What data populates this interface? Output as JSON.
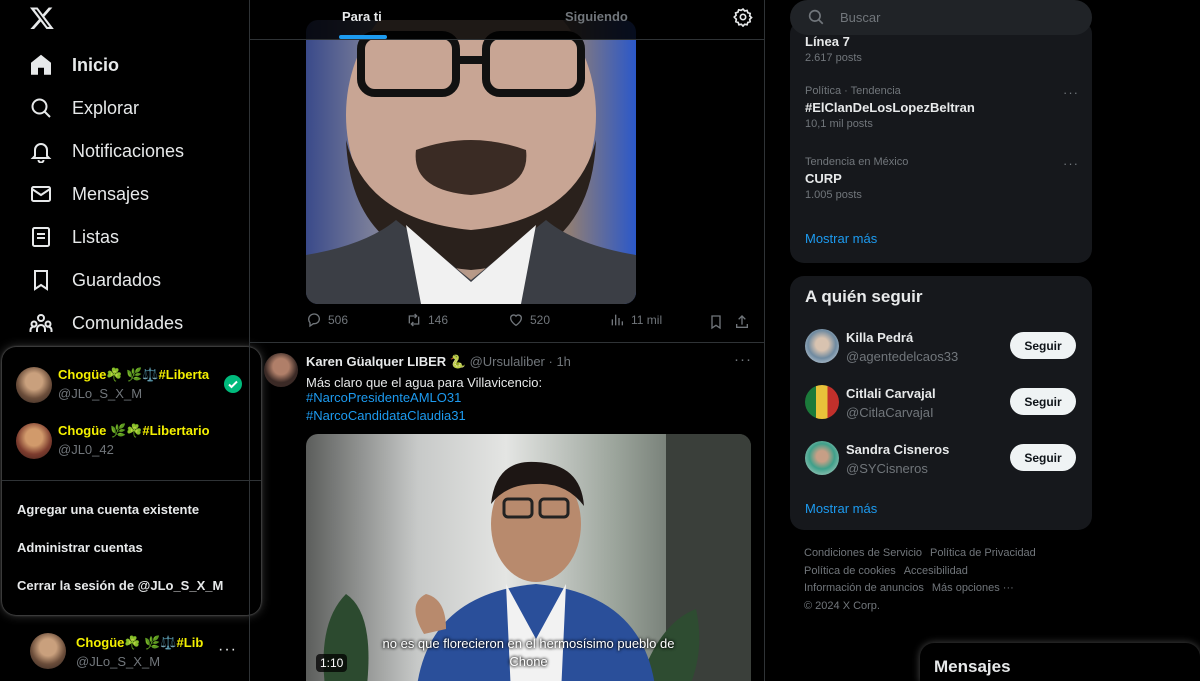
{
  "nav": {
    "items": [
      {
        "label": "Inicio",
        "icon": "home-icon",
        "active": true
      },
      {
        "label": "Explorar",
        "icon": "search-icon"
      },
      {
        "label": "Notificaciones",
        "icon": "bell-icon"
      },
      {
        "label": "Mensajes",
        "icon": "mail-icon"
      },
      {
        "label": "Listas",
        "icon": "list-icon"
      },
      {
        "label": "Guardados",
        "icon": "bookmark-icon"
      },
      {
        "label": "Comunidades",
        "icon": "communities-icon"
      }
    ]
  },
  "account_popup": {
    "accounts": [
      {
        "name": "Chogüe☘️ 🌿⚖️#Liberta",
        "handle": "@JLo_S_X_M",
        "active": true
      },
      {
        "name": "Chogüe 🌿☘️#Libertario",
        "handle": "@JL0_42"
      }
    ],
    "add_existing": "Agregar una cuenta existente",
    "manage": "Administrar cuentas",
    "logout": "Cerrar la sesión de @JLo_S_X_M"
  },
  "current_account": {
    "name": "Chogüe☘️ 🌿⚖️#Lib",
    "handle": "@JLo_S_X_M"
  },
  "feed": {
    "tabs": [
      {
        "label": "Para ti",
        "active": true
      },
      {
        "label": "Siguiendo"
      }
    ],
    "post1": {
      "replies": "506",
      "reposts": "146",
      "likes": "520",
      "views": "11 mil"
    },
    "post2": {
      "author": "Karen Güalquer LIBER 🐍",
      "handle": "@Ursulaliber",
      "time": "· 1h",
      "text": "Más claro que el agua para Villavicencio:",
      "hashtags": [
        "#NarcoPresidenteAMLO31",
        "#NarcoCandidataClaudia31"
      ],
      "subtitle_line1": "no es que florecieron en el hermosísimo pueblo de",
      "subtitle_line2": "Chone",
      "duration": "1:10"
    }
  },
  "right": {
    "search_placeholder": "Buscar",
    "trends": [
      {
        "context": "",
        "name": "Línea 7",
        "count": "2.617 posts"
      },
      {
        "context": "Política · Tendencia",
        "name": "#ElClanDeLosLopezBeltran",
        "count": "10,1 mil posts"
      },
      {
        "context": "Tendencia en México",
        "name": "CURP",
        "count": "1.005 posts"
      }
    ],
    "trends_show_more": "Mostrar más",
    "who_to_follow": {
      "title": "A quién seguir",
      "users": [
        {
          "name": "Killa Pedrá",
          "handle": "@agentedelcaos33",
          "button": "Seguir"
        },
        {
          "name": "Citlali Carvajal",
          "handle": "@CitlaCarvajaI",
          "button": "Seguir"
        },
        {
          "name": "Sandra Cisneros",
          "handle": "@SYCisneros",
          "button": "Seguir"
        }
      ],
      "show_more": "Mostrar más"
    },
    "footer": {
      "links": [
        "Condiciones de Servicio",
        "Política de Privacidad",
        "Política de cookies",
        "Accesibilidad",
        "Información de anuncios",
        "Más opciones ···"
      ],
      "copyright": "© 2024 X Corp."
    }
  },
  "messages_drawer": {
    "title": "Mensajes"
  }
}
